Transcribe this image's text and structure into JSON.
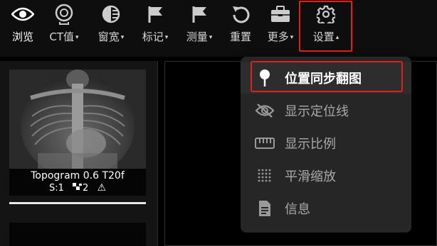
{
  "toolbar": {
    "items": [
      {
        "label": "浏览",
        "icon": "eye-icon",
        "has_caret": false
      },
      {
        "label": "CT值",
        "icon": "ct-value-icon",
        "has_caret": true
      },
      {
        "label": "窗宽",
        "icon": "window-contrast-icon",
        "has_caret": true
      },
      {
        "label": "标记",
        "icon": "flag-icon",
        "has_caret": true
      },
      {
        "label": "测量",
        "icon": "measure-flag-icon",
        "has_caret": true
      },
      {
        "label": "重置",
        "icon": "reset-icon",
        "has_caret": false
      },
      {
        "label": "更多",
        "icon": "toolbox-icon",
        "has_caret": true
      },
      {
        "label": "设置",
        "icon": "gear-icon",
        "has_caret": true,
        "caret_up": true
      }
    ],
    "caret_down": "▾",
    "caret_up": "▴"
  },
  "series": {
    "thumbnails": [
      {
        "title": "Topogram 0.6 T20f",
        "series_number": "S:1",
        "image_count": "2",
        "warning": "⚠"
      }
    ]
  },
  "settings_menu": {
    "items": [
      {
        "label": "位置同步翻图",
        "icon": "pin-icon",
        "active": true
      },
      {
        "label": "显示定位线",
        "icon": "eye-slash-icon",
        "active": false
      },
      {
        "label": "显示比例",
        "icon": "ruler-icon",
        "active": false
      },
      {
        "label": "平滑缩放",
        "icon": "dots-grid-icon",
        "active": false
      },
      {
        "label": "信息",
        "icon": "document-icon",
        "active": false
      }
    ]
  },
  "colors": {
    "highlight": "#e01f1f",
    "toolbar_bg": "#0e0e0e",
    "menu_bg": "#262626"
  }
}
